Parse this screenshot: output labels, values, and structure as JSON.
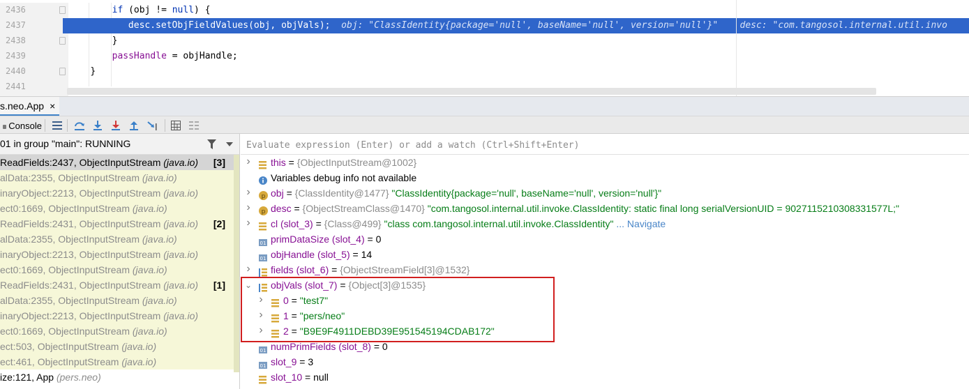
{
  "editor": {
    "lines": [
      {
        "number": "2436",
        "code_kw": "if",
        "code_rest": " (obj != ",
        "code_kw2": "null",
        "code_tail": ") {",
        "indent": "        "
      },
      {
        "number": "2437",
        "code": "desc.setObjFieldValues(obj, objVals);",
        "indent": "            ",
        "hint1": "obj: \"ClassIdentity{package='null', baseName='null', version='null'}\"",
        "hint2": "desc: \"com.tangosol.internal.util.invo"
      },
      {
        "number": "2438",
        "code": "}",
        "indent": "        "
      },
      {
        "number": "2439",
        "field": "passHandle",
        "code_rest": " = objHandle;",
        "indent": "        "
      },
      {
        "number": "2440",
        "code": "}",
        "indent": "    "
      },
      {
        "number": "2441",
        "code": "",
        "indent": ""
      }
    ]
  },
  "debug_tab": {
    "label": "s.neo.App",
    "close": "×"
  },
  "toolbar": {
    "console_label": "Console",
    "icons": [
      "frames-layout-icon",
      "show-execution-point-icon",
      "step-over-icon",
      "step-into-icon",
      "force-step-into-icon",
      "step-out-icon",
      "run-to-cursor-icon",
      "evaluate-expression-icon",
      "trace-icon"
    ]
  },
  "thread": {
    "label": "01 in group \"main\": RUNNING"
  },
  "frames": [
    {
      "method": "ReadFields:2437, ObjectInputStream",
      "pkg": "(java.io)",
      "badge": "[3]",
      "selected": true
    },
    {
      "method": "alData:2355, ObjectInputStream",
      "pkg": "(java.io)",
      "badge": ""
    },
    {
      "method": "inaryObject:2213, ObjectInputStream",
      "pkg": "(java.io)",
      "badge": ""
    },
    {
      "method": "ect0:1669, ObjectInputStream",
      "pkg": "(java.io)",
      "badge": ""
    },
    {
      "method": "ReadFields:2431, ObjectInputStream",
      "pkg": "(java.io)",
      "badge": "[2]"
    },
    {
      "method": "alData:2355, ObjectInputStream",
      "pkg": "(java.io)",
      "badge": ""
    },
    {
      "method": "inaryObject:2213, ObjectInputStream",
      "pkg": "(java.io)",
      "badge": ""
    },
    {
      "method": "ect0:1669, ObjectInputStream",
      "pkg": "(java.io)",
      "badge": ""
    },
    {
      "method": "ReadFields:2431, ObjectInputStream",
      "pkg": "(java.io)",
      "badge": "[1]"
    },
    {
      "method": "alData:2355, ObjectInputStream",
      "pkg": "(java.io)",
      "badge": ""
    },
    {
      "method": "inaryObject:2213, ObjectInputStream",
      "pkg": "(java.io)",
      "badge": ""
    },
    {
      "method": "ect0:1669, ObjectInputStream",
      "pkg": "(java.io)",
      "badge": ""
    },
    {
      "method": "ect:503, ObjectInputStream",
      "pkg": "(java.io)",
      "badge": ""
    },
    {
      "method": "ect:461, ObjectInputStream",
      "pkg": "(java.io)",
      "badge": ""
    },
    {
      "method": "ize:121, App",
      "pkg": "(pers.neo)",
      "badge": "",
      "plain": true
    }
  ],
  "eval": {
    "placeholder": "Evaluate expression (Enter) or add a watch (Ctrl+Shift+Enter)"
  },
  "variables": [
    {
      "name": "this",
      "eq": " = ",
      "type": "{ObjectInputStream@1002}",
      "value": "",
      "icon": "field-icon",
      "expandable": true
    },
    {
      "info": "Variables debug info not available",
      "icon": "info-icon"
    },
    {
      "name": "obj",
      "eq": " = ",
      "type": "{ClassIdentity@1477}",
      "value": " \"ClassIdentity{package='null', baseName='null', version='null'}\"",
      "icon": "parameter-icon",
      "expandable": true
    },
    {
      "name": "desc",
      "eq": " = ",
      "type": "{ObjectStreamClass@1470}",
      "value": " \"com.tangosol.internal.util.invoke.ClassIdentity: static final long serialVersionUID = 9027115210308331577L;\"",
      "icon": "parameter-icon",
      "expandable": true
    },
    {
      "name": "cl (slot_3)",
      "eq": " = ",
      "type": "{Class@499}",
      "value": " \"class com.tangosol.internal.util.invoke.ClassIdentity\"",
      "nav": " ... Navigate",
      "icon": "field-icon",
      "expandable": true
    },
    {
      "name": "primDataSize (slot_4)",
      "eq": " = ",
      "num": "0",
      "icon": "primitive-icon"
    },
    {
      "name": "objHandle (slot_5)",
      "eq": " = ",
      "num": "14",
      "icon": "primitive-icon"
    },
    {
      "name": "fields (slot_6)",
      "eq": " = ",
      "type": "{ObjectStreamField[3]@1532}",
      "value": "",
      "icon": "array-icon",
      "expandable": true
    },
    {
      "name": "objVals (slot_7)",
      "eq": " = ",
      "type": "{Object[3]@1535}",
      "value": "",
      "icon": "array-icon",
      "expanded": true
    },
    {
      "name": "0",
      "eq": " = ",
      "str": "\"test7\"",
      "icon": "field-icon",
      "expandable": true,
      "child": true
    },
    {
      "name": "1",
      "eq": " = ",
      "str": "\"pers/neo\"",
      "icon": "field-icon",
      "expandable": true,
      "child": true
    },
    {
      "name": "2",
      "eq": " = ",
      "str": "\"B9E9F4911DEBD39E951545194CDAB172\"",
      "icon": "field-icon",
      "expandable": true,
      "child": true
    },
    {
      "name": "numPrimFields (slot_8)",
      "eq": " = ",
      "num": "0",
      "icon": "primitive-icon"
    },
    {
      "name": "slot_9",
      "eq": " = ",
      "num": "3",
      "icon": "primitive-icon"
    },
    {
      "name": "slot_10",
      "eq": " = ",
      "num": "null",
      "icon": "field-icon"
    }
  ],
  "colors": {
    "accent": "#2f65ca",
    "highlight_border": "#d11f1f",
    "frames_bg": "#f6f7d8"
  }
}
